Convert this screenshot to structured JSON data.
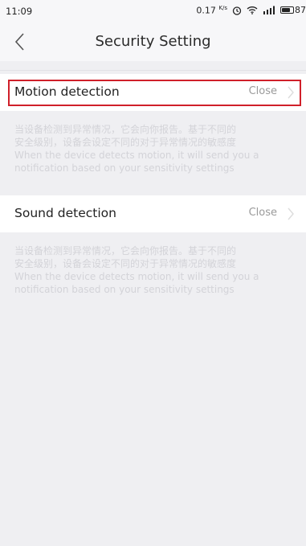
{
  "status_bar": {
    "time": "11:09",
    "speed_value": "0.17",
    "speed_unit": "K/s",
    "battery_level": "87",
    "icons": [
      "alarm-clock-icon",
      "wifi-icon",
      "cellular-signal-icon",
      "battery-icon"
    ]
  },
  "nav": {
    "title": "Security Setting",
    "back_icon": "chevron-left-icon"
  },
  "settings": [
    {
      "label": "Motion detection",
      "value": "Close",
      "description": [
        "当设备检测到异常情况，它会向你报告。基于不同的",
        "安全级别，设备会设定不同的对于异常情况的敏感度",
        "When the device detects motion, it will send you a",
        "notification based on your sensitivity settings"
      ]
    },
    {
      "label": "Sound detection",
      "value": "Close",
      "description": [
        "当设备检测到异常情况，它会向你报告。基于不同的",
        "安全级别，设备会设定不同的对于异常情况的敏感度",
        "When the device detects motion, it will send you a",
        "notification based on your sensitivity settings"
      ]
    }
  ],
  "colors": {
    "background": "#efeff2",
    "row_background": "#ffffff",
    "highlight_border": "#d0202a",
    "value_text": "#9a9a9a",
    "description_text": "#d3d3d8"
  }
}
